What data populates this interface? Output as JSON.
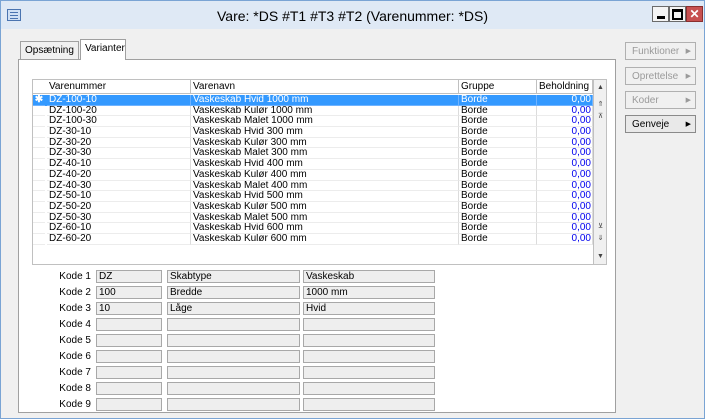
{
  "window": {
    "title": "Vare: *DS   #T1 #T3 #T2 (Varenummer: *DS)"
  },
  "tabs": [
    {
      "label": "Opsætning"
    },
    {
      "label": "Varianter"
    }
  ],
  "grid": {
    "columns": [
      "Varenummer",
      "Varenavn",
      "Gruppe",
      "Beholdning"
    ],
    "rows": [
      {
        "marker": "✱",
        "num": "DZ-100-10",
        "name": "Vaskeskab Hvid 1000 mm",
        "group": "Borde",
        "balance": "0,00"
      },
      {
        "marker": "",
        "num": "DZ-100-20",
        "name": "Vaskeskab Kulør 1000 mm",
        "group": "Borde",
        "balance": "0,00"
      },
      {
        "marker": "",
        "num": "DZ-100-30",
        "name": "Vaskeskab Malet 1000 mm",
        "group": "Borde",
        "balance": "0,00"
      },
      {
        "marker": "",
        "num": "DZ-30-10",
        "name": "Vaskeskab Hvid 300 mm",
        "group": "Borde",
        "balance": "0,00"
      },
      {
        "marker": "",
        "num": "DZ-30-20",
        "name": "Vaskeskab Kulør 300 mm",
        "group": "Borde",
        "balance": "0,00"
      },
      {
        "marker": "",
        "num": "DZ-30-30",
        "name": "Vaskeskab Malet 300 mm",
        "group": "Borde",
        "balance": "0,00"
      },
      {
        "marker": "",
        "num": "DZ-40-10",
        "name": "Vaskeskab Hvid 400 mm",
        "group": "Borde",
        "balance": "0,00"
      },
      {
        "marker": "",
        "num": "DZ-40-20",
        "name": "Vaskeskab Kulør 400 mm",
        "group": "Borde",
        "balance": "0,00"
      },
      {
        "marker": "",
        "num": "DZ-40-30",
        "name": "Vaskeskab Malet 400 mm",
        "group": "Borde",
        "balance": "0,00"
      },
      {
        "marker": "",
        "num": "DZ-50-10",
        "name": "Vaskeskab Hvid 500 mm",
        "group": "Borde",
        "balance": "0,00"
      },
      {
        "marker": "",
        "num": "DZ-50-20",
        "name": "Vaskeskab Kulør 500 mm",
        "group": "Borde",
        "balance": "0,00"
      },
      {
        "marker": "",
        "num": "DZ-50-30",
        "name": "Vaskeskab Malet 500 mm",
        "group": "Borde",
        "balance": "0,00"
      },
      {
        "marker": "",
        "num": "DZ-60-10",
        "name": "Vaskeskab Hvid 600 mm",
        "group": "Borde",
        "balance": "0,00"
      },
      {
        "marker": "",
        "num": "DZ-60-20",
        "name": "Vaskeskab Kulør 600 mm",
        "group": "Borde",
        "balance": "0,00"
      }
    ]
  },
  "codes": [
    {
      "label": "Kode 1",
      "v1": "DZ",
      "v2": "Skabtype",
      "v3": "Vaskeskab"
    },
    {
      "label": "Kode 2",
      "v1": "100",
      "v2": "Bredde",
      "v3": "1000 mm"
    },
    {
      "label": "Kode 3",
      "v1": "10",
      "v2": "Låge",
      "v3": "Hvid"
    },
    {
      "label": "Kode 4",
      "v1": "",
      "v2": "",
      "v3": ""
    },
    {
      "label": "Kode 5",
      "v1": "",
      "v2": "",
      "v3": ""
    },
    {
      "label": "Kode 6",
      "v1": "",
      "v2": "",
      "v3": ""
    },
    {
      "label": "Kode 7",
      "v1": "",
      "v2": "",
      "v3": ""
    },
    {
      "label": "Kode 8",
      "v1": "",
      "v2": "",
      "v3": ""
    },
    {
      "label": "Kode 9",
      "v1": "",
      "v2": "",
      "v3": ""
    }
  ],
  "side_buttons": [
    {
      "label": "Funktioner",
      "enabled": false
    },
    {
      "label": "Oprettelse",
      "enabled": false
    },
    {
      "label": "Koder",
      "enabled": false
    },
    {
      "label": "Genveje",
      "enabled": true
    }
  ],
  "colors": {
    "selection": "#3399ff",
    "close_button": "#c75050",
    "value_link": "#0000ee"
  }
}
